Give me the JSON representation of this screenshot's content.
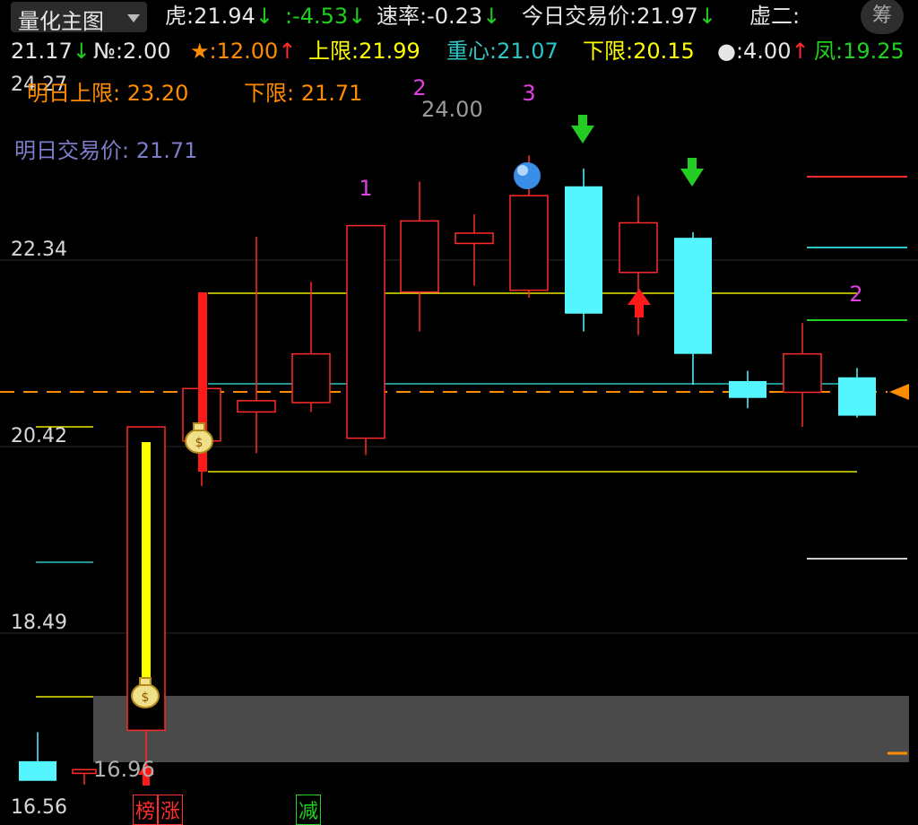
{
  "header": {
    "dropdown_label": "量化主图",
    "tiger": {
      "label": "虎:",
      "value": "21.94"
    },
    "colon": {
      "label": ":",
      "value": "-4.53"
    },
    "rate": {
      "label": "速率:",
      "value": "-0.23"
    },
    "today_price": {
      "label": "今日交易价:",
      "value": "21.97"
    },
    "xu": {
      "label": "虚二:"
    },
    "chou_button": "筹",
    "xu_value": "21.17",
    "no": {
      "label": "№:",
      "value": "2.00"
    },
    "star": {
      "label": "★:",
      "value": "12.00"
    },
    "upper": {
      "label": "上限:",
      "value": "21.99"
    },
    "center": {
      "label": "重心:",
      "value": "21.07"
    },
    "lower": {
      "label": "下限:",
      "value": "20.15"
    },
    "dot": {
      "label": "●:",
      "value": "4.00"
    },
    "phoenix": {
      "label": "凤:",
      "value": "19.25"
    }
  },
  "annotations": {
    "tomorrow_upper": "明日上限: 23.20",
    "tomorrow_lower": "下限: 21.71",
    "tomorrow_price": "明日交易价: 21.71",
    "peak": "24.00",
    "low": "16.96"
  },
  "y_axis": {
    "ticks": [
      "24.27",
      "22.34",
      "20.42",
      "18.49",
      "16.56"
    ],
    "min": 16.56,
    "max": 24.27
  },
  "footer": {
    "tags": [
      "榜",
      "涨",
      "减"
    ]
  },
  "colors": {
    "up": "#ff2a2a",
    "down": "#55f5ff",
    "yellow": "#ffff00",
    "orange": "#ff8c00",
    "magenta": "#e040e0",
    "green": "#20d020"
  },
  "chart_data": {
    "type": "candlestick",
    "candles": [
      {
        "o": 17.05,
        "h": 17.36,
        "l": 16.85,
        "c": 16.84
      },
      {
        "o": 16.92,
        "h": 16.93,
        "l": 16.8,
        "c": 16.96
      },
      {
        "o": 17.38,
        "h": 20.62,
        "l": 16.96,
        "c": 20.62
      },
      {
        "o": 20.47,
        "h": 21.31,
        "l": 19.99,
        "c": 21.03
      },
      {
        "o": 20.78,
        "h": 22.65,
        "l": 20.34,
        "c": 20.9
      },
      {
        "o": 20.88,
        "h": 22.17,
        "l": 20.78,
        "c": 21.4
      },
      {
        "o": 20.5,
        "h": 22.49,
        "l": 20.32,
        "c": 22.77
      },
      {
        "o": 22.06,
        "h": 23.24,
        "l": 21.64,
        "c": 22.82
      },
      {
        "o": 22.58,
        "h": 22.89,
        "l": 22.13,
        "c": 22.69
      },
      {
        "o": 22.08,
        "h": 23.52,
        "l": 22.0,
        "c": 23.09
      },
      {
        "o": 23.19,
        "h": 23.38,
        "l": 21.64,
        "c": 21.83
      },
      {
        "o": 22.27,
        "h": 23.09,
        "l": 21.6,
        "c": 22.8
      },
      {
        "o": 22.64,
        "h": 22.7,
        "l": 21.07,
        "c": 21.4
      },
      {
        "o": 21.11,
        "h": 21.22,
        "l": 20.82,
        "c": 20.93
      },
      {
        "o": 20.99,
        "h": 21.73,
        "l": 20.62,
        "c": 21.4
      },
      {
        "o": 21.15,
        "h": 21.25,
        "l": 20.72,
        "c": 20.74
      }
    ]
  }
}
